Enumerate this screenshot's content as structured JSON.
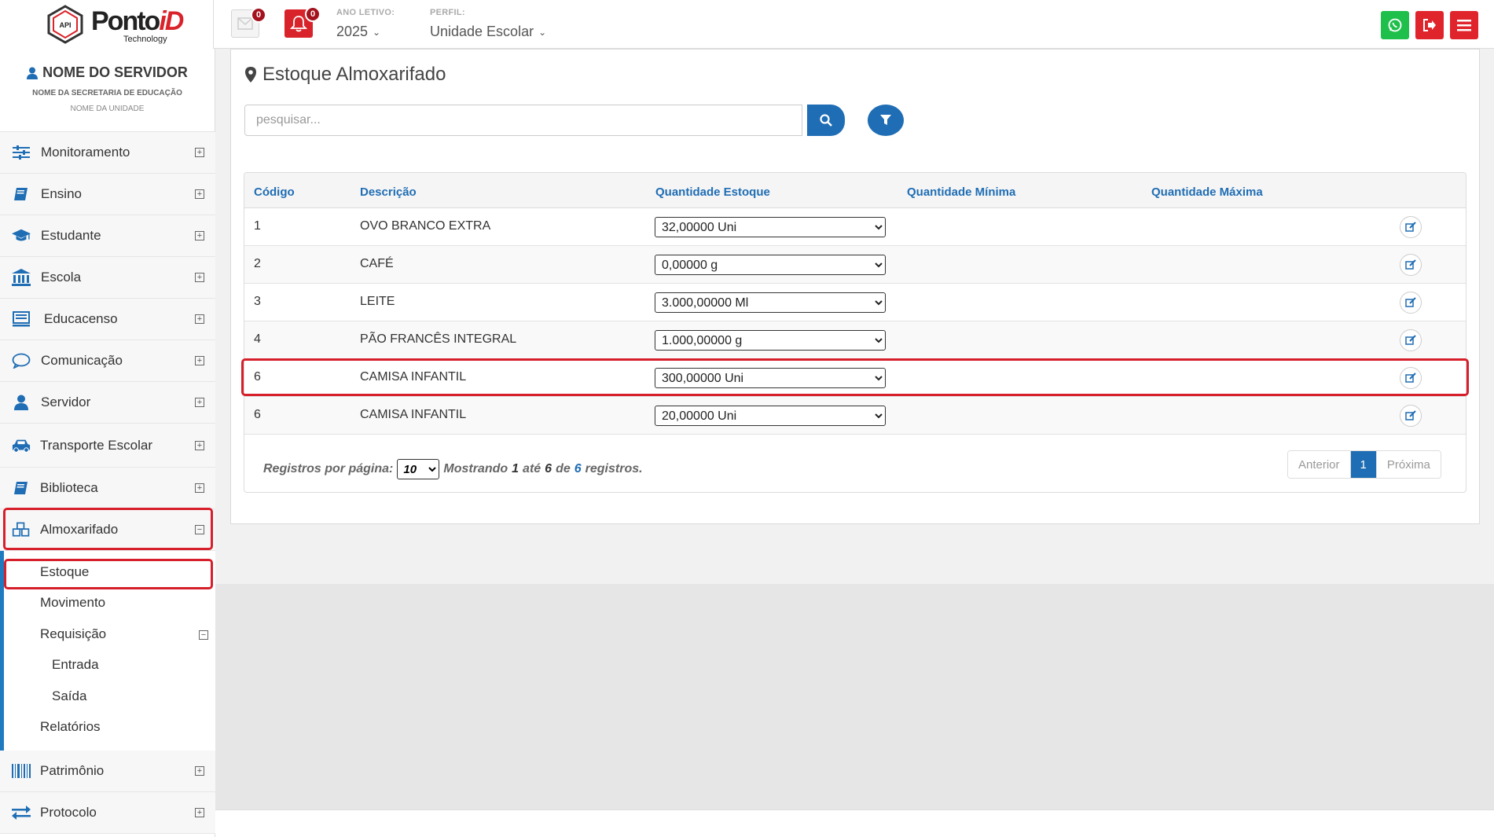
{
  "header": {
    "logo": {
      "brand": "Ponto",
      "brand_accent": "iD",
      "tagline": "Technology",
      "hex_label": "API"
    },
    "mail_count": "0",
    "notification_count": "0",
    "year_label": "ANO LETIVO:",
    "year_value": "2025",
    "profile_label": "PERFIL:",
    "profile_value": "Unidade Escolar"
  },
  "user": {
    "name": "NOME DO SERVIDOR",
    "secretariat": "NOME DA SECRETARIA DE EDUCAÇÃO",
    "unit": "NOME DA UNIDADE"
  },
  "sidebar": {
    "items": [
      {
        "label": "Monitoramento",
        "icon": "sliders-icon"
      },
      {
        "label": "Ensino",
        "icon": "book-icon"
      },
      {
        "label": "Estudante",
        "icon": "graduation-cap-icon"
      },
      {
        "label": "Escola",
        "icon": "institution-icon"
      },
      {
        "label": "Educacenso",
        "icon": "monitor-list-icon"
      },
      {
        "label": "Comunicação",
        "icon": "chat-bubble-icon"
      },
      {
        "label": "Servidor",
        "icon": "user-icon"
      },
      {
        "label": "Transporte Escolar",
        "icon": "car-icon"
      },
      {
        "label": "Biblioteca",
        "icon": "book-icon"
      },
      {
        "label": "Almoxarifado",
        "icon": "cubes-icon"
      },
      {
        "label": "Patrimônio",
        "icon": "barcode-icon"
      },
      {
        "label": "Protocolo",
        "icon": "exchange-icon"
      }
    ],
    "sub_items": [
      {
        "label": "Estoque"
      },
      {
        "label": "Movimento"
      },
      {
        "label": "Requisição"
      },
      {
        "label": "Entrada"
      },
      {
        "label": "Saída"
      },
      {
        "label": "Relatórios"
      }
    ]
  },
  "page": {
    "title": "Estoque Almoxarifado",
    "search_placeholder": "pesquisar..."
  },
  "table": {
    "columns": [
      "Código",
      "Descrição",
      "Quantidade Estoque",
      "Quantidade Mínima",
      "Quantidade Máxima"
    ],
    "rows": [
      {
        "code": "1",
        "description": "OVO BRANCO EXTRA",
        "quantity": "32,00000 Uni"
      },
      {
        "code": "2",
        "description": "CAFÉ",
        "quantity": "0,00000 g"
      },
      {
        "code": "3",
        "description": "LEITE",
        "quantity": "3.000,00000 Ml"
      },
      {
        "code": "4",
        "description": "PÃO FRANCÊS INTEGRAL",
        "quantity": "1.000,00000 g"
      },
      {
        "code": "6",
        "description": "CAMISA INFANTIL",
        "quantity": "300,00000 Uni"
      },
      {
        "code": "6",
        "description": "CAMISA INFANTIL",
        "quantity": "20,00000 Uni"
      }
    ]
  },
  "footer": {
    "per_page_label": "Registros por página:",
    "per_page_value": "10",
    "showing": "Mostrando",
    "from": "1",
    "until": "até",
    "to": "6",
    "of": "de",
    "total": "6",
    "records": "registros."
  },
  "pagination": {
    "prev": "Anterior",
    "current": "1",
    "next": "Próxima"
  },
  "colors": {
    "primary": "#1f6db4",
    "danger": "#e0242c",
    "whatsapp": "#1fbf4b",
    "highlight": "#d61f2b"
  }
}
